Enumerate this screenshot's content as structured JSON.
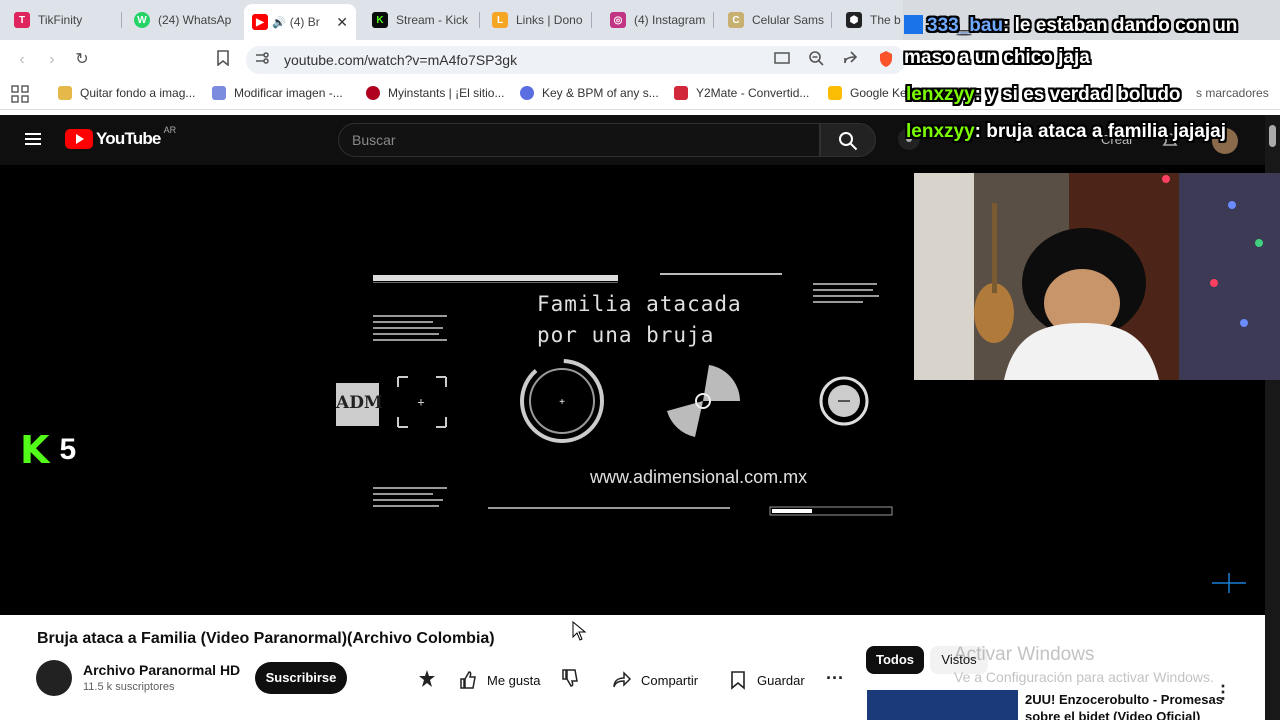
{
  "browser": {
    "tabs": [
      {
        "label": "TikFinity",
        "color": "#e0245e",
        "glyph": "T"
      },
      {
        "label": "(24) WhatsAp",
        "color": "#25d366",
        "glyph": "W"
      },
      {
        "label": "(4) Br",
        "color": "#ff0000",
        "glyph": "▶"
      },
      {
        "label": "Stream - Kick",
        "color": "#0b0b0b",
        "glyph": "K"
      },
      {
        "label": "Links | Dono",
        "color": "#f5a623",
        "glyph": "L"
      },
      {
        "label": "(4) Instagram",
        "color": "#c13584",
        "glyph": "◎"
      },
      {
        "label": "Celular Sams",
        "color": "#c8b070",
        "glyph": "C"
      },
      {
        "label": "The b",
        "color": "#222222",
        "glyph": "⬢"
      }
    ],
    "url": "youtube.com/watch?v=mA4fo7SP3gk",
    "bookmarks": [
      {
        "label": "Quitar fondo a imag...",
        "color": "#e5b84a"
      },
      {
        "label": "Modificar imagen -...",
        "color": "#7b8cde"
      },
      {
        "label": "Myinstants | ¡El sitio...",
        "color": "#b00020"
      },
      {
        "label": "Key & BPM of any s...",
        "color": "#5b6ee1"
      },
      {
        "label": "Y2Mate - Convertid...",
        "color": "#d2283c"
      },
      {
        "label": "Google Ke",
        "color": "#fbbc04"
      }
    ],
    "bookmarks_more": "s marcadores"
  },
  "youtube": {
    "logo_text": "YouTube",
    "region": "AR",
    "search_placeholder": "Buscar",
    "create_label": "Crear",
    "video": {
      "title_line1": "Familia atacada",
      "title_line2": "por una bruja",
      "adm_logo": "ADM",
      "website": "www.adimensional.com.mx",
      "kick_count": "5"
    },
    "title": "Bruja ataca a Familia (Video Paranormal)(Archivo Colombia)",
    "channel": "Archivo Paranormal HD",
    "subscribers": "11.5 k suscriptores",
    "subscribe_label": "Suscribirse",
    "like_label": "Me gusta",
    "share_label": "Compartir",
    "save_label": "Guardar",
    "chips": [
      "Todos",
      "Vistos"
    ],
    "recommendation": {
      "title_line1": "2UU! Enzocerobulto - Promesas",
      "title_line2": "sobre el bidet (Video Oficial)"
    }
  },
  "windows_watermark": {
    "line1": "Activar Windows",
    "line2": "Ve a Configuración para activar Windows."
  },
  "chat": [
    {
      "user": "333_bau",
      "message": ": le estaban dando con un",
      "user_color": "#6fa8ff"
    },
    {
      "user": "",
      "message": "maso a un chico jaja",
      "user_color": "#ffffff"
    },
    {
      "user": "lenxzyy",
      "message": ": y si es verdad boludo",
      "user_color": "#7cfc00"
    },
    {
      "user": "lenxzyy",
      "message": ": bruja ataca a familia jajajaj",
      "user_color": "#7cfc00"
    }
  ]
}
